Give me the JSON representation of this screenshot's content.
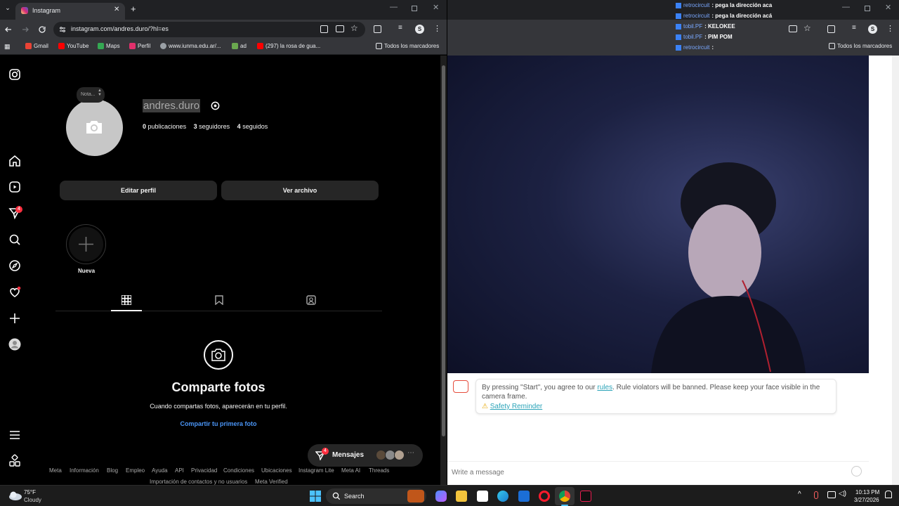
{
  "left_browser": {
    "tab_title": "Instagram",
    "url": "instagram.com/andres.duro/?hl=es",
    "bookmarks": [
      {
        "label": "Gmail",
        "color": "#ea4335"
      },
      {
        "label": "YouTube",
        "color": "#ff0000"
      },
      {
        "label": "Maps",
        "color": "#34a853"
      },
      {
        "label": "Perfil",
        "color": "#e1306c"
      },
      {
        "label": "www.iunma.edu.ar/...",
        "color": "#9aa0a6"
      },
      {
        "label": "ad",
        "color": "#6aa84f"
      },
      {
        "label": "(297) la rosa de gua...",
        "color": "#ff0000"
      }
    ],
    "all_bookmarks": "Todos los marcadores",
    "profile_avatar_letter": "S"
  },
  "instagram": {
    "note_label": "Nota...",
    "username": "andres.duro",
    "stats": {
      "posts_count": "0",
      "posts_label": "publicaciones",
      "followers_count": "3",
      "followers_label": "seguidores",
      "following_count": "4",
      "following_label": "seguidos"
    },
    "edit_profile": "Editar perfil",
    "view_archive": "Ver archivo",
    "new_highlight": "Nueva",
    "empty_title": "Comparte fotos",
    "empty_subtitle": "Cuando compartas fotos, aparecerán en tu perfil.",
    "share_first": "Compartir tu primera foto",
    "notifications_badge": "4",
    "messages_label": "Mensajes",
    "messages_badge": "4",
    "footer_row1": [
      "Meta",
      "Información",
      "Blog",
      "Empleo",
      "Ayuda",
      "API",
      "Privacidad",
      "Condiciones",
      "Ubicaciones",
      "Instagram Lite",
      "Meta AI",
      "Threads"
    ],
    "footer_row2": [
      "Importación de contactos y no usuarios",
      "Meta Verified"
    ]
  },
  "right_browser": {
    "chat": [
      {
        "user": "retrocircuit",
        "message": ": pega la dirección aca"
      },
      {
        "user": "retrocircuit",
        "message": ": pega la dirección acá"
      },
      {
        "user": "tobil.PF",
        "message": ": KELOKEE"
      },
      {
        "user": "tobil.PF",
        "message": ": PIM POM"
      },
      {
        "user": "retrocircuit",
        "message": ":"
      }
    ],
    "all_bookmarks": "Todos los marcadores",
    "profile_avatar_letter": "S",
    "notice_text_before": "By pressing \"Start\", you agree to our ",
    "notice_link": "rules",
    "notice_text_after": ". Rule violators will be banned. Please keep your face visible in the camera frame.",
    "safety_reminder": "Safety Reminder",
    "message_placeholder": "Write a message"
  },
  "taskbar": {
    "weather_temp": "75°F",
    "weather_desc": "Cloudy",
    "search_label": "Search",
    "time": "10:13 PM",
    "date": "3/27/2026"
  }
}
